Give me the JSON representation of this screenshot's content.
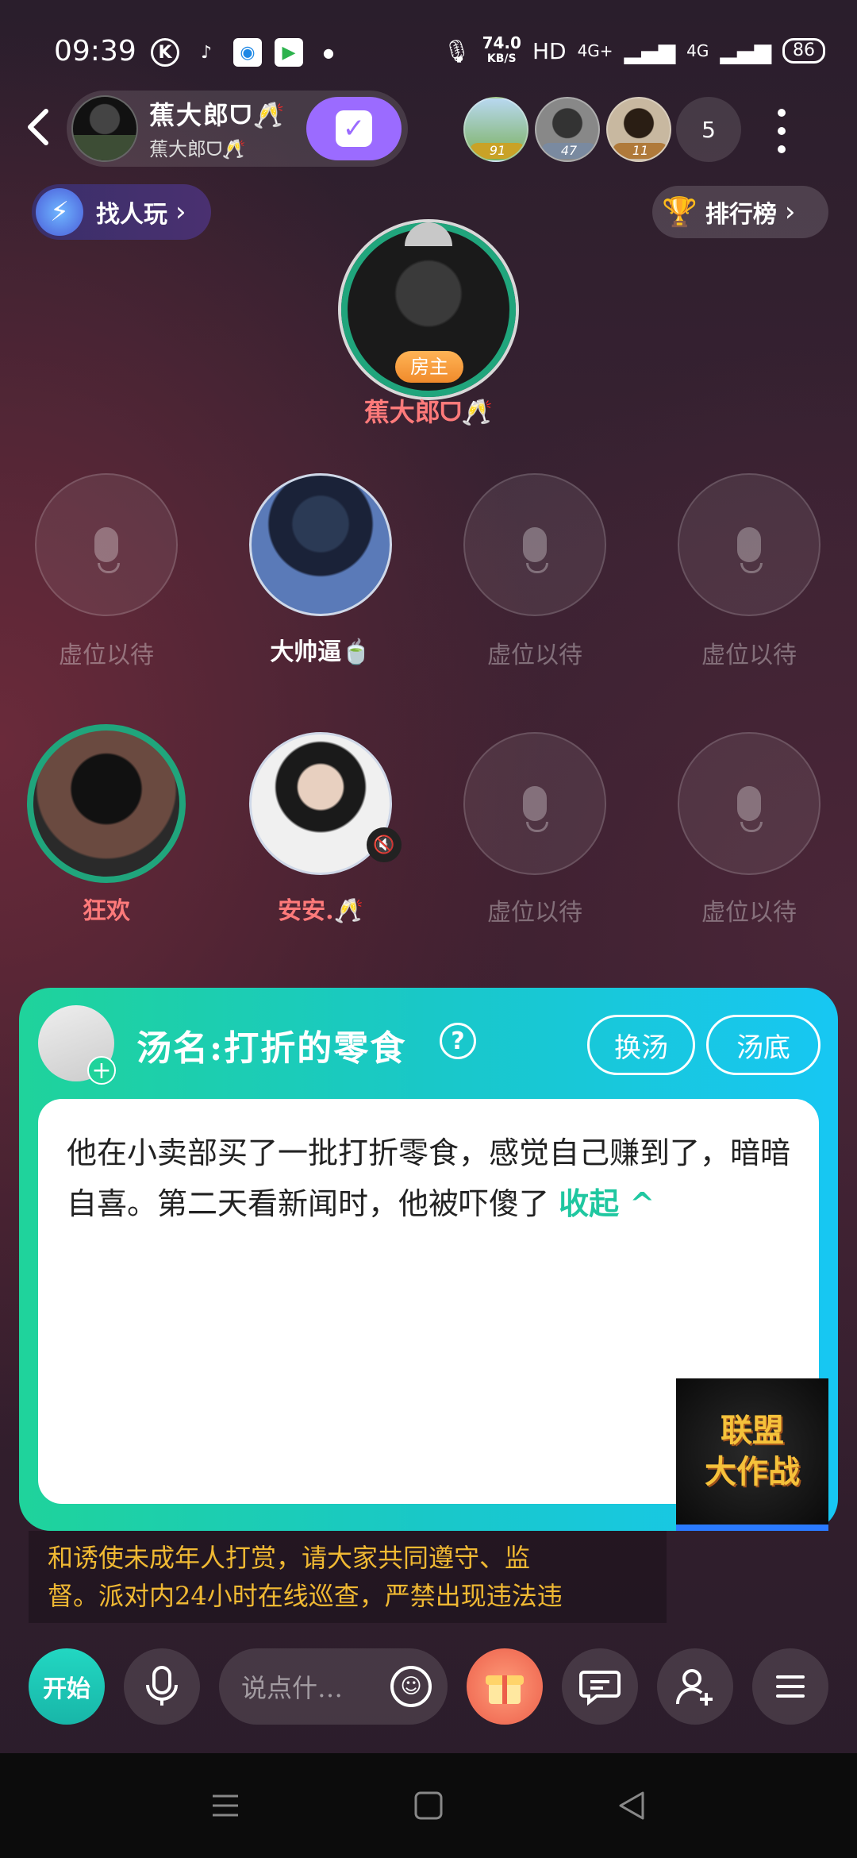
{
  "status_bar": {
    "time": "09:39",
    "speed_value": "74.0",
    "speed_unit": "KB/S",
    "hd_label": "HD",
    "net_label_1": "4G+",
    "net_label_2": "4G",
    "battery": "86"
  },
  "header": {
    "owner_name": "蕉大郎ᗜ🥂",
    "owner_sub": "蕉大郎ᗜ🥂",
    "audience": [
      {
        "badge": "91",
        "badge_color": "#c9a227"
      },
      {
        "badge": "47",
        "badge_color": "#7a8aa0"
      },
      {
        "badge": "11",
        "badge_color": "#b07a3a"
      }
    ],
    "audience_count": "5"
  },
  "actions": {
    "find_label": "找人玩",
    "rank_label": "排行榜"
  },
  "host": {
    "tag": "房主",
    "name": "蕉大郎ᗜ🥂"
  },
  "seats_row1": [
    {
      "label": "虚位以待",
      "empty": true
    },
    {
      "label": "大帅逼🍵",
      "empty": false
    },
    {
      "label": "虚位以待",
      "empty": true
    },
    {
      "label": "虚位以待",
      "empty": true
    }
  ],
  "seats_row2": [
    {
      "label": "狂欢",
      "empty": false
    },
    {
      "label": "安安.🥂",
      "empty": false
    },
    {
      "label": "虚位以待",
      "empty": true
    },
    {
      "label": "虚位以待",
      "empty": true
    }
  ],
  "card": {
    "title": "汤名:打折的零食",
    "help": "?",
    "btn_change": "换汤",
    "btn_answer": "汤底",
    "text": "他在小卖部买了一批打折零食，感觉自己赚到了，暗暗自喜。第二天看新闻时，他被吓傻了",
    "collapse": "收起 ^"
  },
  "event_banner": {
    "line1": "联盟",
    "line2": "大作战"
  },
  "notice": {
    "line1": "和诱使未成年人打赏，请大家共同遵守、监",
    "line2": "督。派对内24小时在线巡查，严禁出现违法违"
  },
  "toolbar": {
    "start": "开始",
    "chat_placeholder": "说点什…"
  }
}
